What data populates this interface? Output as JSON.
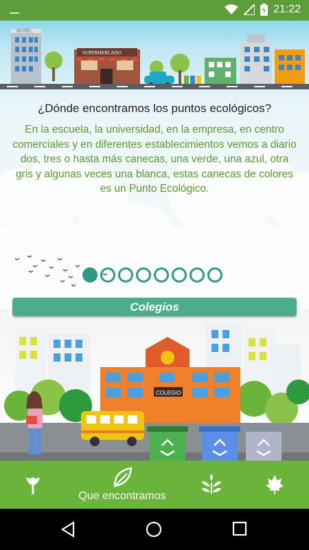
{
  "status_bar": {
    "time": "21:22",
    "icons": [
      "notification-icon",
      "wifi-icon",
      "signal-icon",
      "battery-icon"
    ],
    "color": "#5d9e3a"
  },
  "header_illustration": {
    "signs": [
      "HOTEL",
      "SUPERMERCADO"
    ]
  },
  "main": {
    "question": "¿Dónde encontramos los puntos ecológicos?",
    "description": "En la escuela, la universidad, en la empresa, en centro comerciales y en diferentes establecimientos vemos a diario dos, tres o hasta más canecas, una verde, una azul, otra gris y algunas veces una blanca, estas canecas de colores es un Punto Ecológico.",
    "text_color": "#5a9a2e"
  },
  "pager": {
    "total": 8,
    "active_index": 0,
    "color": "#2e9a86"
  },
  "section": {
    "title": "Colegios",
    "color": "#4cad8c"
  },
  "scene": {
    "school_sign": "COLEGIO",
    "bins": [
      "green",
      "blue",
      "gray"
    ]
  },
  "bottom_nav": {
    "color": "#6ab43b",
    "items": [
      {
        "icon": "tulip-icon",
        "label": ""
      },
      {
        "icon": "leaf-icon",
        "label": "Que encontramos"
      },
      {
        "icon": "sprout-icon",
        "label": ""
      },
      {
        "icon": "maple-leaf-icon",
        "label": ""
      }
    ]
  },
  "system_nav": {
    "buttons": [
      "back-icon",
      "home-icon",
      "recents-icon"
    ]
  }
}
